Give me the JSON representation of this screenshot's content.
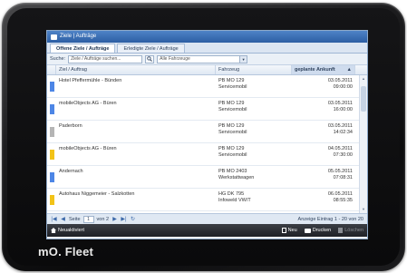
{
  "app": {
    "title": "Ziele | Aufträge",
    "brand": "mO. Fleet"
  },
  "tabs": [
    {
      "label": "Offene Ziele / Aufträge",
      "active": true
    },
    {
      "label": "Erledigte Ziele / Aufträge",
      "active": false
    }
  ],
  "toolbar": {
    "search_label": "Suche:",
    "search_placeholder": "Ziele / Aufträge suchen...",
    "vehicle_filter": "Alle Fahrzeuge"
  },
  "grid": {
    "headers": {
      "goal": "Ziel / Auftrag",
      "vehicle": "Fahrzeug",
      "arrival": "geplante Ankunft"
    },
    "rows": [
      {
        "color": "#4d86e6",
        "goal": "Hotel Pfeffermühle - Bünden",
        "vehicle": "PB MO 129",
        "vehicle_type": "Servicemobil",
        "date": "03.05.2011",
        "time": "09:00:00"
      },
      {
        "color": "#4d86e6",
        "goal": "mobileObjects AG - Büren",
        "vehicle": "PB MO 129",
        "vehicle_type": "Servicemobil",
        "date": "03.05.2011",
        "time": "16:00:00"
      },
      {
        "color": "#b5b5b5",
        "goal": "Paderborn",
        "vehicle": "PB MO 129",
        "vehicle_type": "Servicemobil",
        "date": "03.05.2011",
        "time": "14:02:34"
      },
      {
        "color": "#f2c318",
        "goal": "mobileObjects AG - Büren",
        "vehicle": "PB MO 129",
        "vehicle_type": "Servicemobil",
        "date": "04.05.2011",
        "time": "07:30:00"
      },
      {
        "color": "#4d86e6",
        "goal": "Andernach",
        "vehicle": "PB MO 2403",
        "vehicle_type": "Werkstattwagen",
        "date": "05.05.2011",
        "time": "07:08:31"
      },
      {
        "color": "#f2c318",
        "goal": "Autohaus Niggemeier - Salzkotten",
        "vehicle": "HG DK 795",
        "vehicle_type": "Infoweld VW/T",
        "date": "06.05.2011",
        "time": "08:55:35"
      }
    ]
  },
  "pager": {
    "page_label": "Seite",
    "page_value": "1",
    "of_label": "von 2",
    "info": "Anzeige Eintrag 1 - 20 von 20"
  },
  "bottombar": {
    "home_label": "Neuaktiviert",
    "new_label": "Neu",
    "print_label": "Drucken",
    "delete_label": "Löschen"
  }
}
